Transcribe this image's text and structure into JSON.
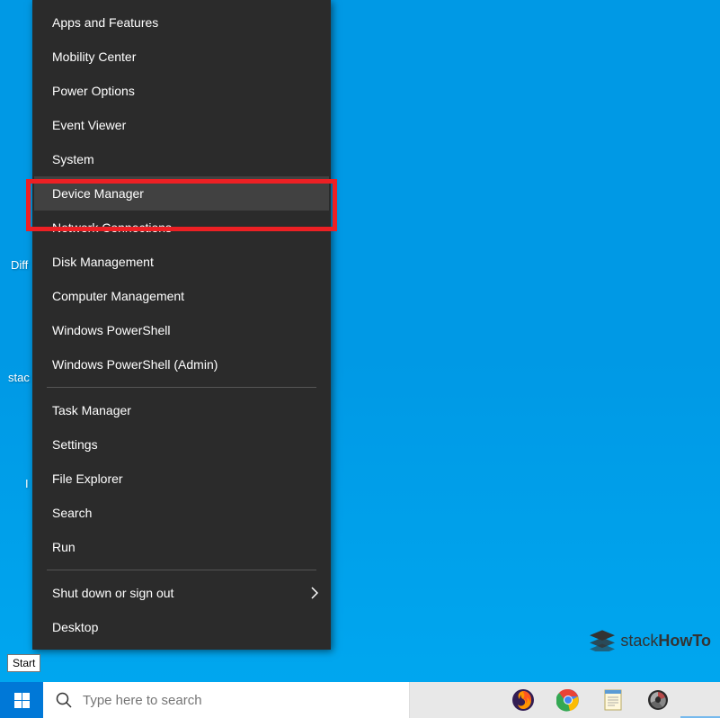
{
  "desktop": {
    "text1": "Diff",
    "text2": "stac",
    "text3": "I"
  },
  "menu": {
    "items_group1": [
      "Apps and Features",
      "Mobility Center",
      "Power Options",
      "Event Viewer",
      "System",
      "Device Manager",
      "Network Connections",
      "Disk Management",
      "Computer Management",
      "Windows PowerShell",
      "Windows PowerShell (Admin)"
    ],
    "items_group2": [
      "Task Manager",
      "Settings",
      "File Explorer",
      "Search",
      "Run"
    ],
    "items_group3": [
      "Shut down or sign out",
      "Desktop"
    ],
    "highlighted_index": 5,
    "submenu_item": "Shut down or sign out"
  },
  "tooltip": {
    "start": "Start"
  },
  "search": {
    "placeholder": "Type here to search"
  },
  "watermark": {
    "prefix": "stack",
    "bold": "HowTo"
  }
}
